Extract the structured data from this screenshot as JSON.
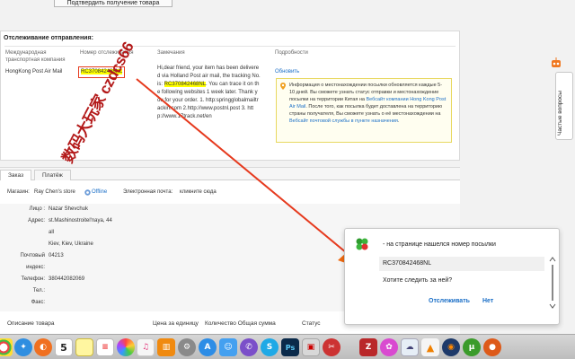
{
  "top_button": {
    "label": "Подтвердить получение товара"
  },
  "tracking": {
    "title": "Отслеживание отправления:",
    "headers": {
      "carrier": "Международная транспортная компания",
      "number": "Номер отслеживания",
      "notes": "Замечания",
      "details": "Подробности"
    },
    "carrier": "HongKong Post Air Mail",
    "number": "RC370842468NL",
    "notes": {
      "line1": "Hi,dear friend, your item has been delivere",
      "line2": "d via Holland Post air mail, the tracking No.",
      "line3a": "is: ",
      "line3b": "RC370842468NL",
      "line3c": ". You can trace it on th",
      "line4": "e following websites 1 week later. Thank y",
      "line5": "ou for your order. 1. http:springglobalmailtr",
      "line6": "ackin.com 2.http://www.postnl.post 3. htt",
      "line7": "p://www.17track.net/en"
    },
    "refresh": "Обновить",
    "info": {
      "t1": "Информация о местонахождении посылки обновляется каждые 5-10 дней. Вы сможете узнать статус отправки и местонахождение посылки на территории Китая на ",
      "link1": "Вебсайт компании Hong Kong Post Air Mail",
      "t2": ". После того, как посылка будет доставлена на территорию страны получателя, Вы сможете узнать о её местонахождении на ",
      "link2": "Вебсайт почтовой службы в пункте назначения",
      "t3": "."
    },
    "watermark": "数码大玩家 czdcs66"
  },
  "order": {
    "tabs": [
      "Заказ",
      "Платёж"
    ],
    "shop_label": "Магазин:",
    "shop_name": "Ray Chen's store",
    "offline": "Offline",
    "email_label": "Электронная почта:",
    "email_link": "кликните сюда",
    "address": {
      "person_k": "Лицо :",
      "person_v": "Nazar Shevchuk",
      "addr_k": "Адрес:",
      "addr_v1": "st.Mashinostroitel'naya, 44",
      "addr_v2": "all",
      "addr_v3": "Kiev, Kiev, Ukraine",
      "zip_k": "Почтовый",
      "zip_v": "04213",
      "index_k": "индекс:",
      "phone_k": "Телефон:",
      "phone_v": "380442082069",
      "tel_k": "Тел.:",
      "fax_k": "Факс:"
    },
    "footer": {
      "desc": "Описание товара",
      "price": "Цена за единицу",
      "qty": "Количество Общая сумма",
      "status": "Статус"
    }
  },
  "sidebar": {
    "questions": "Частые вопросы"
  },
  "popup": {
    "title": "- на странице нашелся номер посылки",
    "number": "RC370842468NL",
    "question": "Хотите следить за ней?",
    "yes": "Отслеживать",
    "no": "Нет"
  },
  "dock": {
    "calendar_day": "5",
    "apps": [
      "chrome-icon",
      "safari-icon",
      "firefox-icon",
      "calendar-icon",
      "notes-icon",
      "reminders-icon",
      "photos-icon",
      "itunes-icon",
      "ibooks-icon",
      "system-prefs-icon",
      "app-store-icon",
      "finder-icon",
      "viber-icon",
      "skype-icon",
      "photoshop-icon",
      "pdf-icon",
      "tool-icon",
      "filezilla-icon",
      "flower-icon",
      "cloud-icon",
      "vlc-icon",
      "firefox-icon-2",
      "utorrent-icon",
      "other-icon"
    ]
  },
  "colors": {
    "accent_red": "#e63a1e",
    "link_blue": "#1b6fc7",
    "highlight": "#ffff00",
    "green_logo": "#2e9b2e"
  }
}
